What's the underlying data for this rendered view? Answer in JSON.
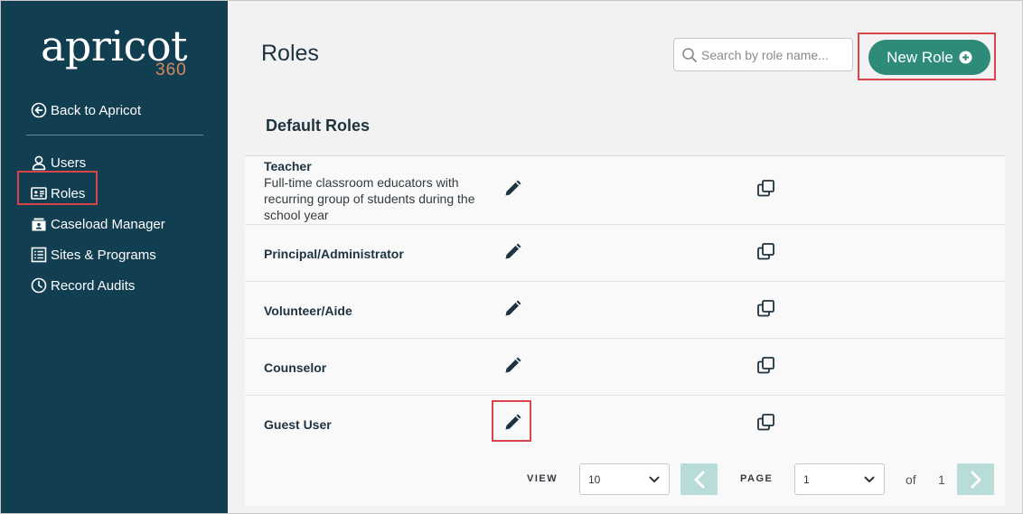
{
  "brand": {
    "word": "apricot",
    "number": "360"
  },
  "sidebar": {
    "back_label": "Back to Apricot",
    "items": [
      {
        "label": "Users",
        "icon": "user-icon"
      },
      {
        "label": "Roles",
        "icon": "id-card-icon"
      },
      {
        "label": "Caseload Manager",
        "icon": "caseload-icon"
      },
      {
        "label": "Sites & Programs",
        "icon": "list-icon"
      },
      {
        "label": "Record Audits",
        "icon": "clock-icon"
      }
    ]
  },
  "header": {
    "title": "Roles",
    "search_placeholder": "Search by role name...",
    "new_role_label": "New Role"
  },
  "section": {
    "title": "Default Roles"
  },
  "roles": [
    {
      "name": "Teacher",
      "description": "Full-time classroom educators with recurring group of students during the school year"
    },
    {
      "name": "Principal/Administrator",
      "description": ""
    },
    {
      "name": "Volunteer/Aide",
      "description": ""
    },
    {
      "name": "Counselor",
      "description": ""
    },
    {
      "name": "Guest User",
      "description": ""
    }
  ],
  "pagination": {
    "view_label": "VIEW",
    "view_value": "10",
    "page_label": "PAGE",
    "page_value": "1",
    "of_label": "of",
    "total_pages": "1"
  },
  "colors": {
    "sidebar_bg": "#123e52",
    "accent": "#2e8b7a",
    "highlight": "#d9454a",
    "logo_number": "#d98a5a"
  }
}
